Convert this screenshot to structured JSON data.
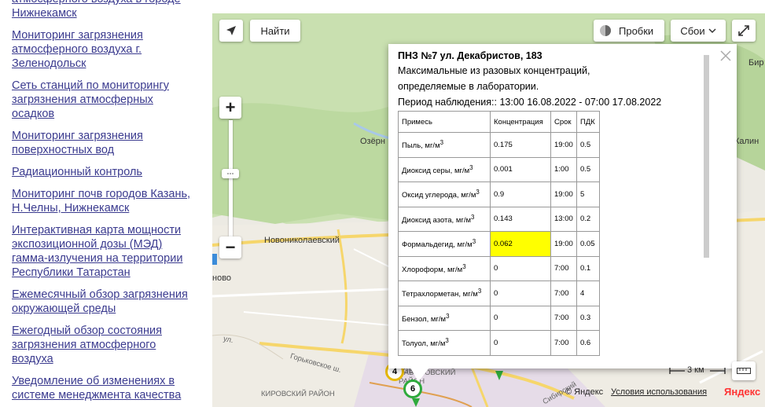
{
  "sidebar": {
    "links": [
      "атмосферного воздуха в городе Нижнекамск",
      "Мониторинг загрязнения атмосферного воздуха г. Зеленодольск",
      "Сеть станций по мониторингу загрязнения атмосферных осадков",
      "Мониторинг загрязнения поверхностных вод",
      "Радиационный контроль",
      "Мониторинг почв городов Казань, Н.Челны, Нижнекамск",
      "Интерактивная карта мощности экспозиционной дозы (МЭД) гамма-излучения на территории Республики Татарстан",
      "Ежемесячный обзор загрязнения окружающей среды",
      "Ежегодный обзор состояния загрязнения атмосферного воздуха",
      "Уведомление об изменениях в системе менеджмента качества"
    ]
  },
  "map": {
    "find_button": "Найти",
    "traffic_button": "Пробки",
    "layers_button": "Сбои",
    "zoom_in": "+",
    "zoom_out": "−",
    "labels": {
      "ozerny": "Озёрн",
      "novonikolaevsky": "Новониколаевский",
      "novo": "ново",
      "ul": "ул.",
      "gorkovskoe": "Горьковское ш.",
      "kirovsky": "КИРОВСКИЙ РАЙОН",
      "savinovsky": "САВИНОВСКИЙ РАЙОН",
      "novo2": "НОВ",
      "sibirsky": "Сибирский",
      "bir": "Бир",
      "kalin": "Калин",
      "kovsk": "ЮВСК"
    },
    "scale_label": "3 км",
    "copyright": "© Яндекс",
    "terms_link": "Условия использования",
    "brand": "Яндекс",
    "markers": [
      "4",
      "6"
    ]
  },
  "balloon": {
    "title": "ПНЗ №7 ул. Декабристов, 183",
    "line1": "Максимальные из разовых концентраций,",
    "line2": "определяемые в лаборатории.",
    "period": "Период наблюдения:: 13:00 16.08.2022 - 07:00 17.08.2022",
    "headers": [
      "Примесь",
      "Концентрация",
      "Срок",
      "ПДК"
    ],
    "rows": [
      {
        "name": "Пыль, мг/м",
        "conc": "0.175",
        "time": "19:00",
        "pdk": "0.5",
        "highlight": false
      },
      {
        "name": "Диоксид серы, мг/м",
        "conc": "0.001",
        "time": "1:00",
        "pdk": "0.5",
        "highlight": false
      },
      {
        "name": "Оксид углерода, мг/м",
        "conc": "0.9",
        "time": "19:00",
        "pdk": "5",
        "highlight": false
      },
      {
        "name": "Диоксид азота, мг/м",
        "conc": "0.143",
        "time": "13:00",
        "pdk": "0.2",
        "highlight": false
      },
      {
        "name": "Формальдегид, мг/м",
        "conc": "0.062",
        "time": "19:00",
        "pdk": "0.05",
        "highlight": true
      },
      {
        "name": "Хлороформ, мг/м",
        "conc": "0",
        "time": "7:00",
        "pdk": "0.1",
        "highlight": false
      },
      {
        "name": "Тетрахлорметан, мг/м",
        "conc": "0",
        "time": "7:00",
        "pdk": "4",
        "highlight": false
      },
      {
        "name": "Бензол, мг/м",
        "conc": "0",
        "time": "7:00",
        "pdk": "0.3",
        "highlight": false
      },
      {
        "name": "Толуол, мг/м",
        "conc": "0",
        "time": "7:00",
        "pdk": "0.6",
        "highlight": false
      }
    ],
    "unit_sup": "3",
    "highlight_color": "#ffff00"
  }
}
